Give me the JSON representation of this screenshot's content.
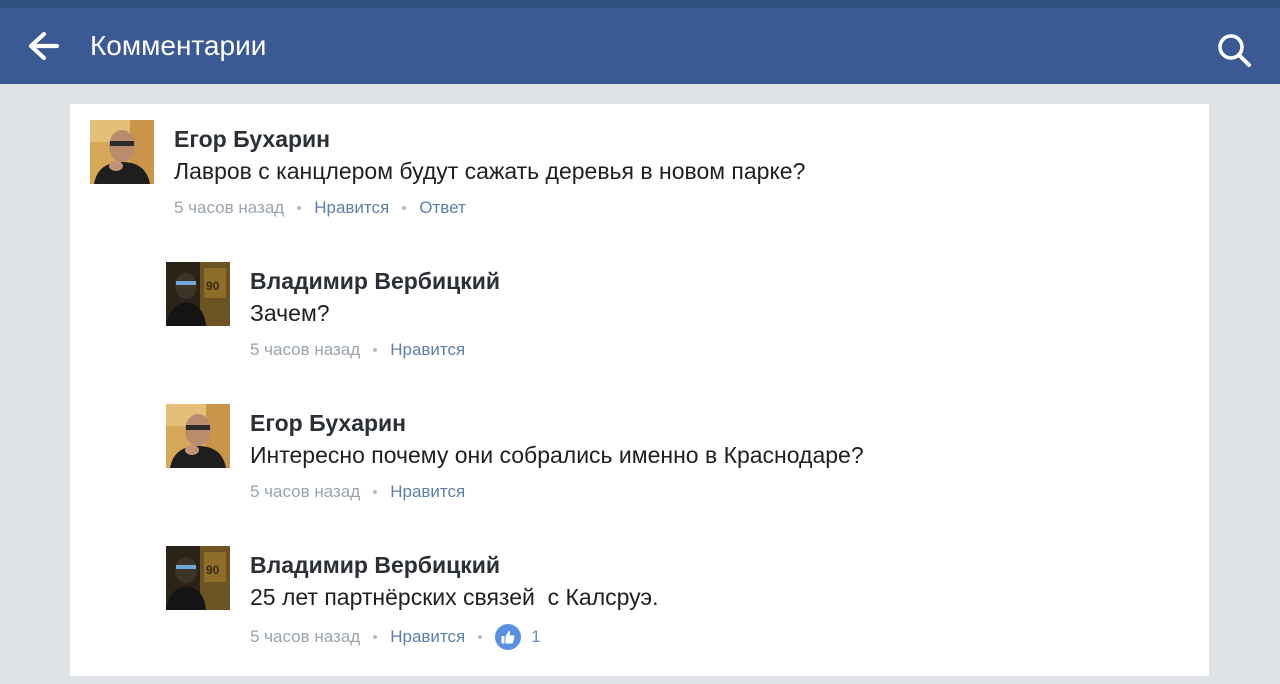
{
  "header": {
    "title": "Комментарии",
    "back_icon": "arrow-left-icon",
    "search_icon": "search-icon"
  },
  "colors": {
    "header_bg": "#3b5a94",
    "link": "#5d7fa8",
    "like_badge": "#5b8fe0"
  },
  "comments": [
    {
      "author": "Егор Бухарин",
      "text": "Лавров с канцлером будут сажать деревья в новом парке?",
      "time": "5 часов назад",
      "like_label": "Нравится",
      "reply_label": "Ответ"
    },
    {
      "author": "Владимир Вербицкий",
      "text": "Зачем?",
      "time": "5 часов назад",
      "like_label": "Нравится"
    },
    {
      "author": "Егор Бухарин",
      "text": "Интересно почему они собрались именно в Краснодаре?",
      "time": "5 часов назад",
      "like_label": "Нравится"
    },
    {
      "author": "Владимир Вербицкий",
      "text": "25 лет партнёрских связей  с Калсруэ.",
      "time": "5 часов назад",
      "like_label": "Нравится",
      "likes_count": "1"
    }
  ]
}
